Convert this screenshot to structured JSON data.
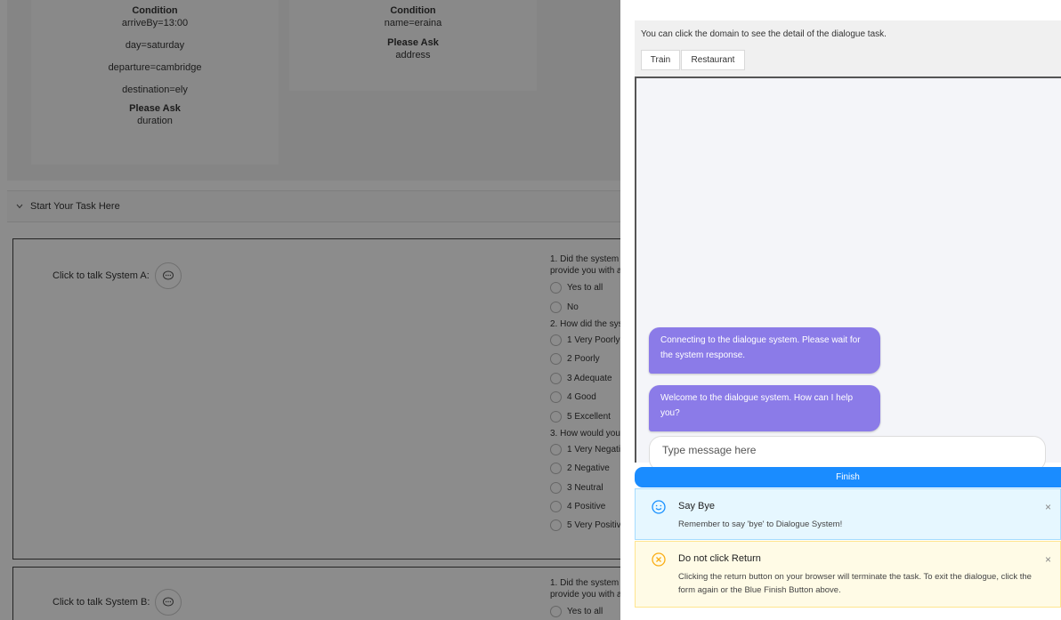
{
  "left": {
    "card1": {
      "condition_heading": "Condition",
      "conditions": [
        "arriveBy=13:00",
        "day=saturday",
        "departure=cambridge",
        "destination=ely"
      ],
      "ask_heading": "Please Ask",
      "ask_value": "duration"
    },
    "card2": {
      "condition_heading": "Condition",
      "conditions": [
        "name=eraina"
      ],
      "ask_heading": "Please Ask",
      "ask_value": "address"
    },
    "collapse_label": "Start Your Task Here",
    "systemA": {
      "talk_label": "Click to talk System A:",
      "q1": "1. Did the system",
      "q1b": "provide you with a",
      "q1_options": [
        "Yes to all",
        "No"
      ],
      "q2": "2. How did the sys",
      "q2_options": [
        "1 Very Poorly",
        "2 Poorly",
        "3 Adequate",
        "4 Good",
        "5 Excellent"
      ],
      "q3": "3. How would you",
      "q3_options": [
        "1 Very Negati",
        "2 Negative",
        "3 Neutral",
        "4 Positive",
        "5 Very Positiv"
      ]
    },
    "systemB": {
      "talk_label": "Click to talk System B:",
      "q1": "1. Did the system",
      "q1b": "provide you with a",
      "q1_options": [
        "Yes to all"
      ]
    }
  },
  "panel": {
    "hint": "You can click the domain to see the detail of the dialogue task.",
    "domains": [
      "Train",
      "Restaurant"
    ],
    "messages": [
      "Connecting to the dialogue system. Please wait for the system response.",
      "Welcome to the dialogue system. How can I help you?"
    ],
    "input_placeholder": "Type message here",
    "finish_label": "Finish",
    "alert_info": {
      "title": "Say Bye",
      "desc": "Remember to say 'bye' to Dialogue System!",
      "color": "#1890ff"
    },
    "alert_warn": {
      "title": "Do not click Return",
      "desc": "Clicking the return button on your browser will terminate the task. To exit the dialogue, click the form again or the Blue Finish Button above.",
      "color": "#faad14"
    },
    "close_glyph": "×"
  }
}
